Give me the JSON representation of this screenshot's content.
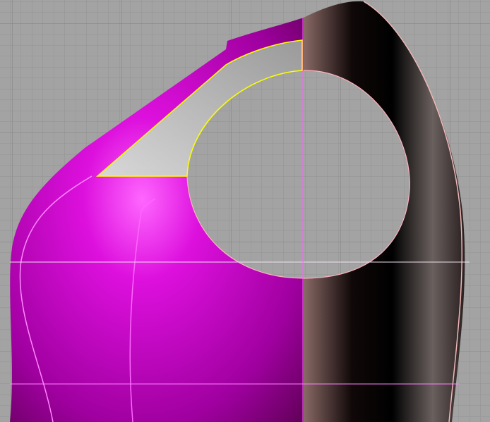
{
  "viewport": {
    "background": "#a3a3a3",
    "grid_color": "#8f8f8f",
    "grid_major_color": "#7e7e7e",
    "front_color": "#cc00cc",
    "back_color": "#1a1212",
    "panel_color": "#c4c4c4",
    "selection_color": "#ffff00",
    "back_outline_color": "#f0b8b8"
  }
}
